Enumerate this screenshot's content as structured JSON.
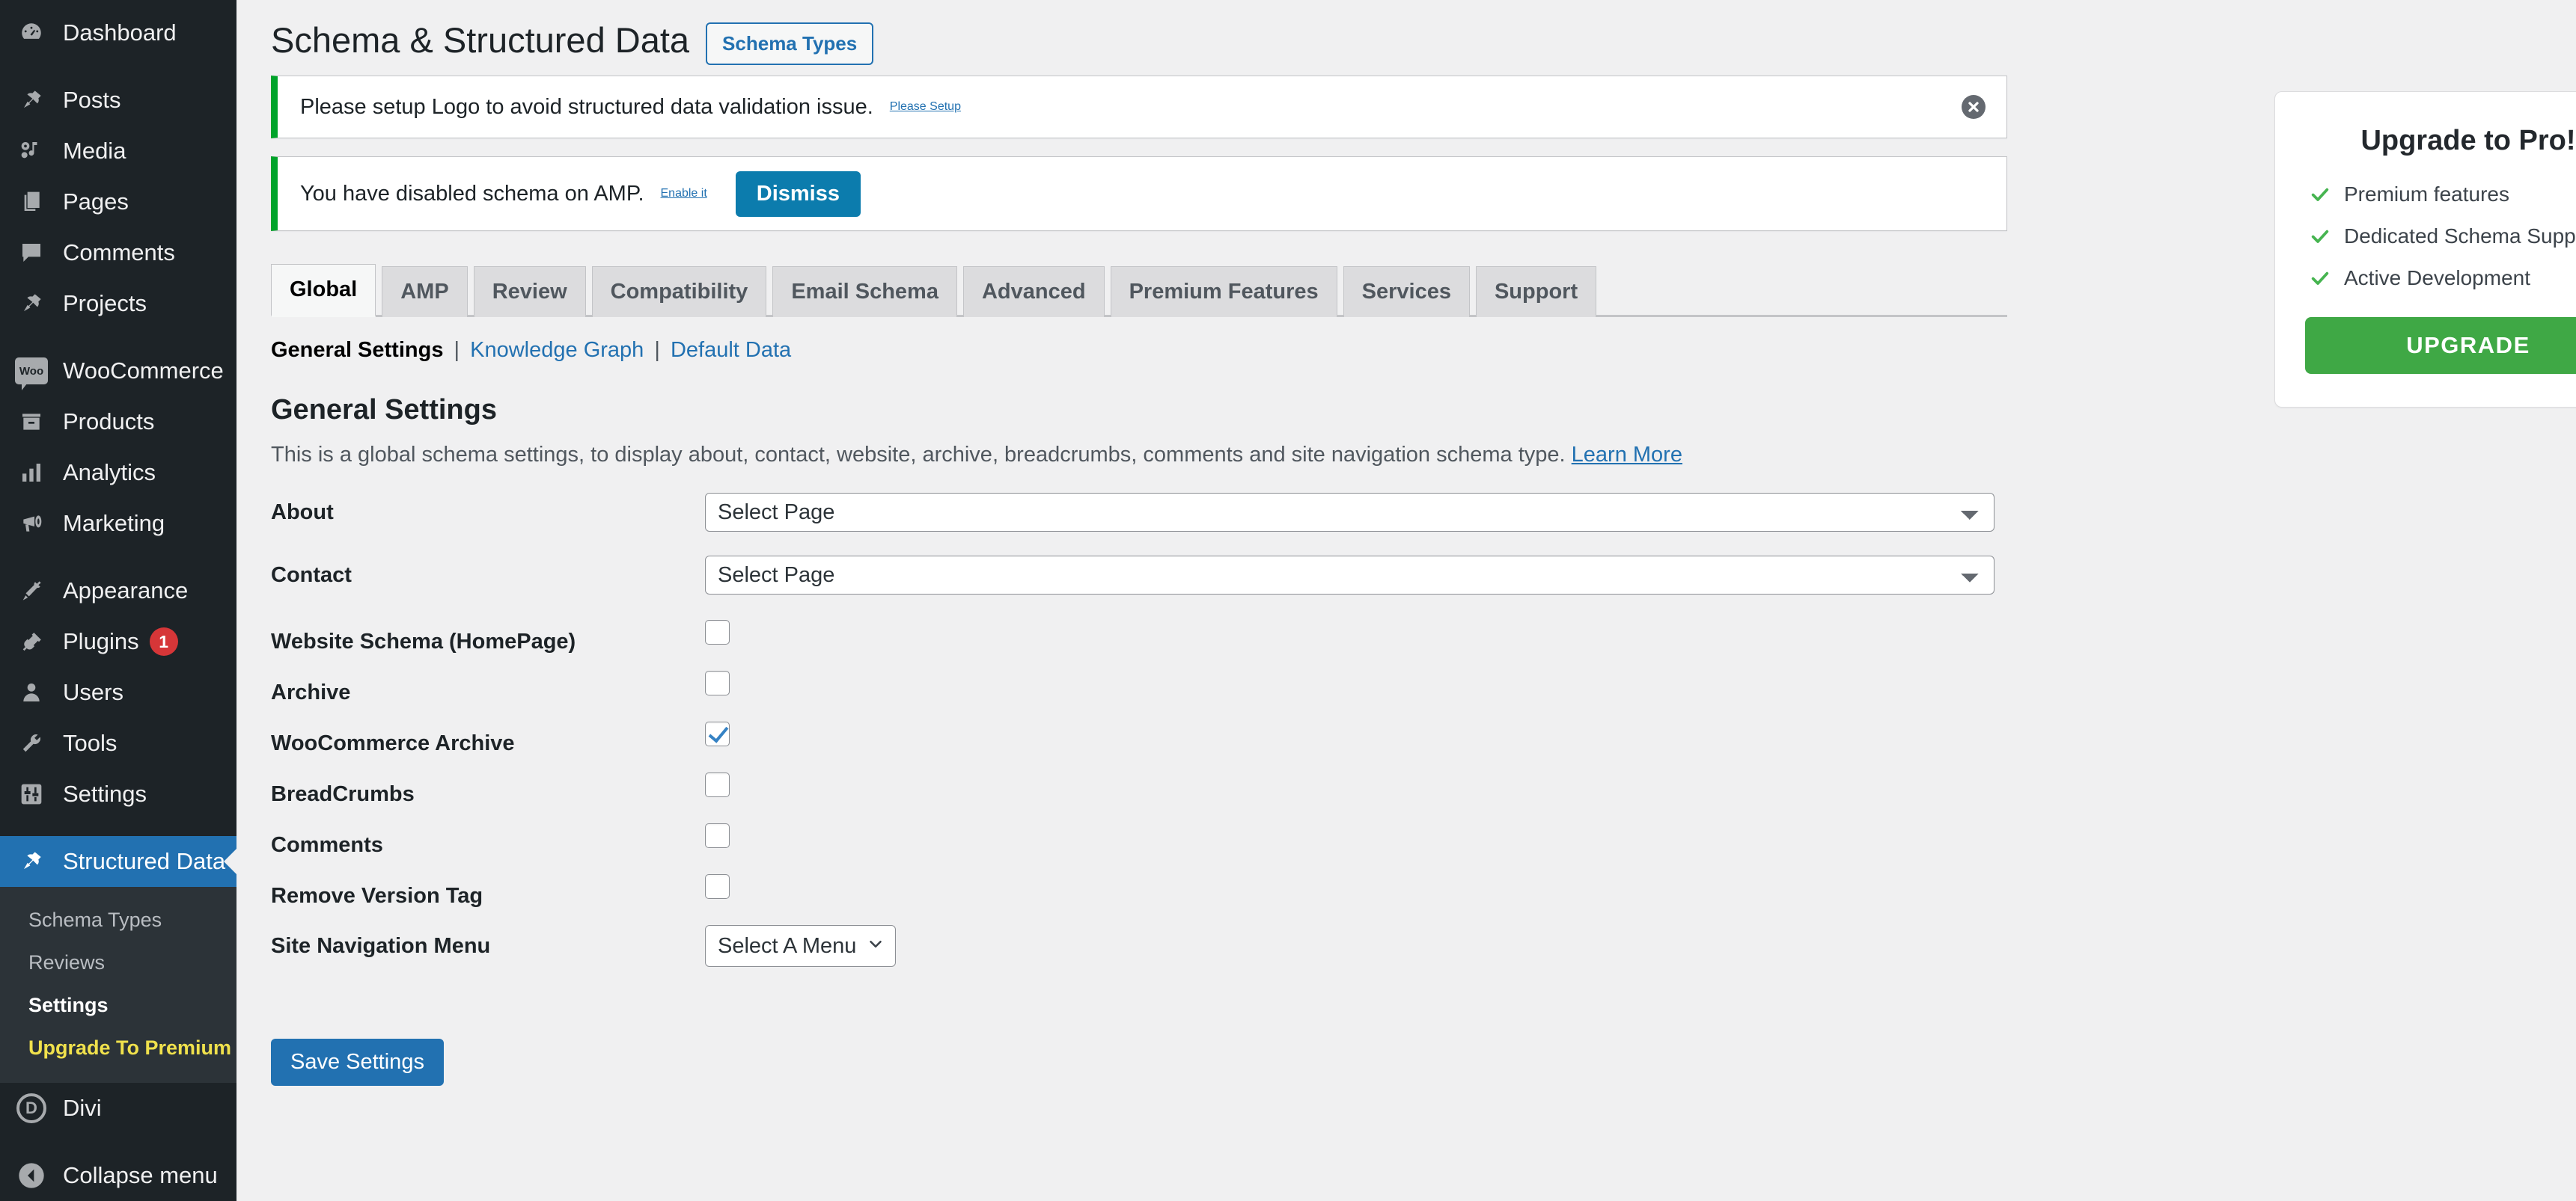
{
  "sidebar": {
    "items": [
      {
        "label": "Dashboard",
        "icon": "dashboard-icon"
      },
      {
        "label": "Posts",
        "icon": "pin-icon"
      },
      {
        "label": "Media",
        "icon": "media-icon"
      },
      {
        "label": "Pages",
        "icon": "pages-icon"
      },
      {
        "label": "Comments",
        "icon": "comments-icon"
      },
      {
        "label": "Projects",
        "icon": "pin-icon"
      },
      {
        "label": "WooCommerce",
        "icon": "woo-icon"
      },
      {
        "label": "Products",
        "icon": "products-icon"
      },
      {
        "label": "Analytics",
        "icon": "analytics-icon"
      },
      {
        "label": "Marketing",
        "icon": "marketing-icon"
      },
      {
        "label": "Appearance",
        "icon": "appearance-icon"
      },
      {
        "label": "Plugins",
        "icon": "plugins-icon",
        "badge": "1"
      },
      {
        "label": "Users",
        "icon": "users-icon"
      },
      {
        "label": "Tools",
        "icon": "tools-icon"
      },
      {
        "label": "Settings",
        "icon": "settings-icon"
      },
      {
        "label": "Structured Data",
        "icon": "pin-icon",
        "current": true
      },
      {
        "label": "Divi",
        "icon": "divi-icon"
      }
    ],
    "submenu": [
      {
        "label": "Schema Types"
      },
      {
        "label": "Reviews"
      },
      {
        "label": "Settings",
        "current": true
      },
      {
        "label": "Upgrade To Premium",
        "premium": true
      }
    ],
    "collapse_label": "Collapse menu",
    "woo_badge_text": "Woo",
    "divi_badge_text": "D",
    "plugins_badge": "1",
    "accent_current": "#2271b1",
    "badge_color": "#d63638",
    "premium_color": "#f0e14c"
  },
  "header": {
    "title": "Schema & Structured Data",
    "action_label": "Schema Types"
  },
  "notices": [
    {
      "text": "Please setup Logo to avoid structured data validation issue.",
      "link_label": "Please Setup",
      "dismiss_icon": "close-circle-icon",
      "accent": "#00a32a"
    },
    {
      "text": "You have disabled schema on AMP.",
      "link_label": "Enable it",
      "button_label": "Dismiss",
      "button_color": "#0c7cad",
      "accent": "#00a32a"
    }
  ],
  "tabs": [
    {
      "label": "Global",
      "active": true
    },
    {
      "label": "AMP"
    },
    {
      "label": "Review"
    },
    {
      "label": "Compatibility"
    },
    {
      "label": "Email Schema"
    },
    {
      "label": "Advanced"
    },
    {
      "label": "Premium Features"
    },
    {
      "label": "Services"
    },
    {
      "label": "Support"
    }
  ],
  "subnav": {
    "current": "General Settings",
    "sep1": "|",
    "link1": "Knowledge Graph",
    "sep2": "|",
    "link2": "Default Data"
  },
  "section": {
    "title": "General Settings",
    "description": "This is a global schema settings, to display about, contact, website, archive, breadcrumbs, comments and site navigation schema type.",
    "learn_more": "Learn More"
  },
  "form": {
    "about": {
      "label": "About",
      "value": "Select Page"
    },
    "contact": {
      "label": "Contact",
      "value": "Select Page"
    },
    "checkboxes": [
      {
        "label": "Website Schema (HomePage)",
        "checked": false
      },
      {
        "label": "Archive",
        "checked": false
      },
      {
        "label": "WooCommerce Archive",
        "checked": true
      },
      {
        "label": "BreadCrumbs",
        "checked": false
      },
      {
        "label": "Comments",
        "checked": false
      },
      {
        "label": "Remove Version Tag",
        "checked": false
      }
    ],
    "site_nav": {
      "label": "Site Navigation Menu",
      "value": "Select A Menu"
    },
    "save_label": "Save Settings"
  },
  "upgrade": {
    "title": "Upgrade to Pro!",
    "features": [
      "Premium features",
      "Dedicated Schema Support",
      "Active Development"
    ],
    "button_label": "UPGRADE",
    "button_color": "#3fa845",
    "check_color": "#46b450"
  }
}
